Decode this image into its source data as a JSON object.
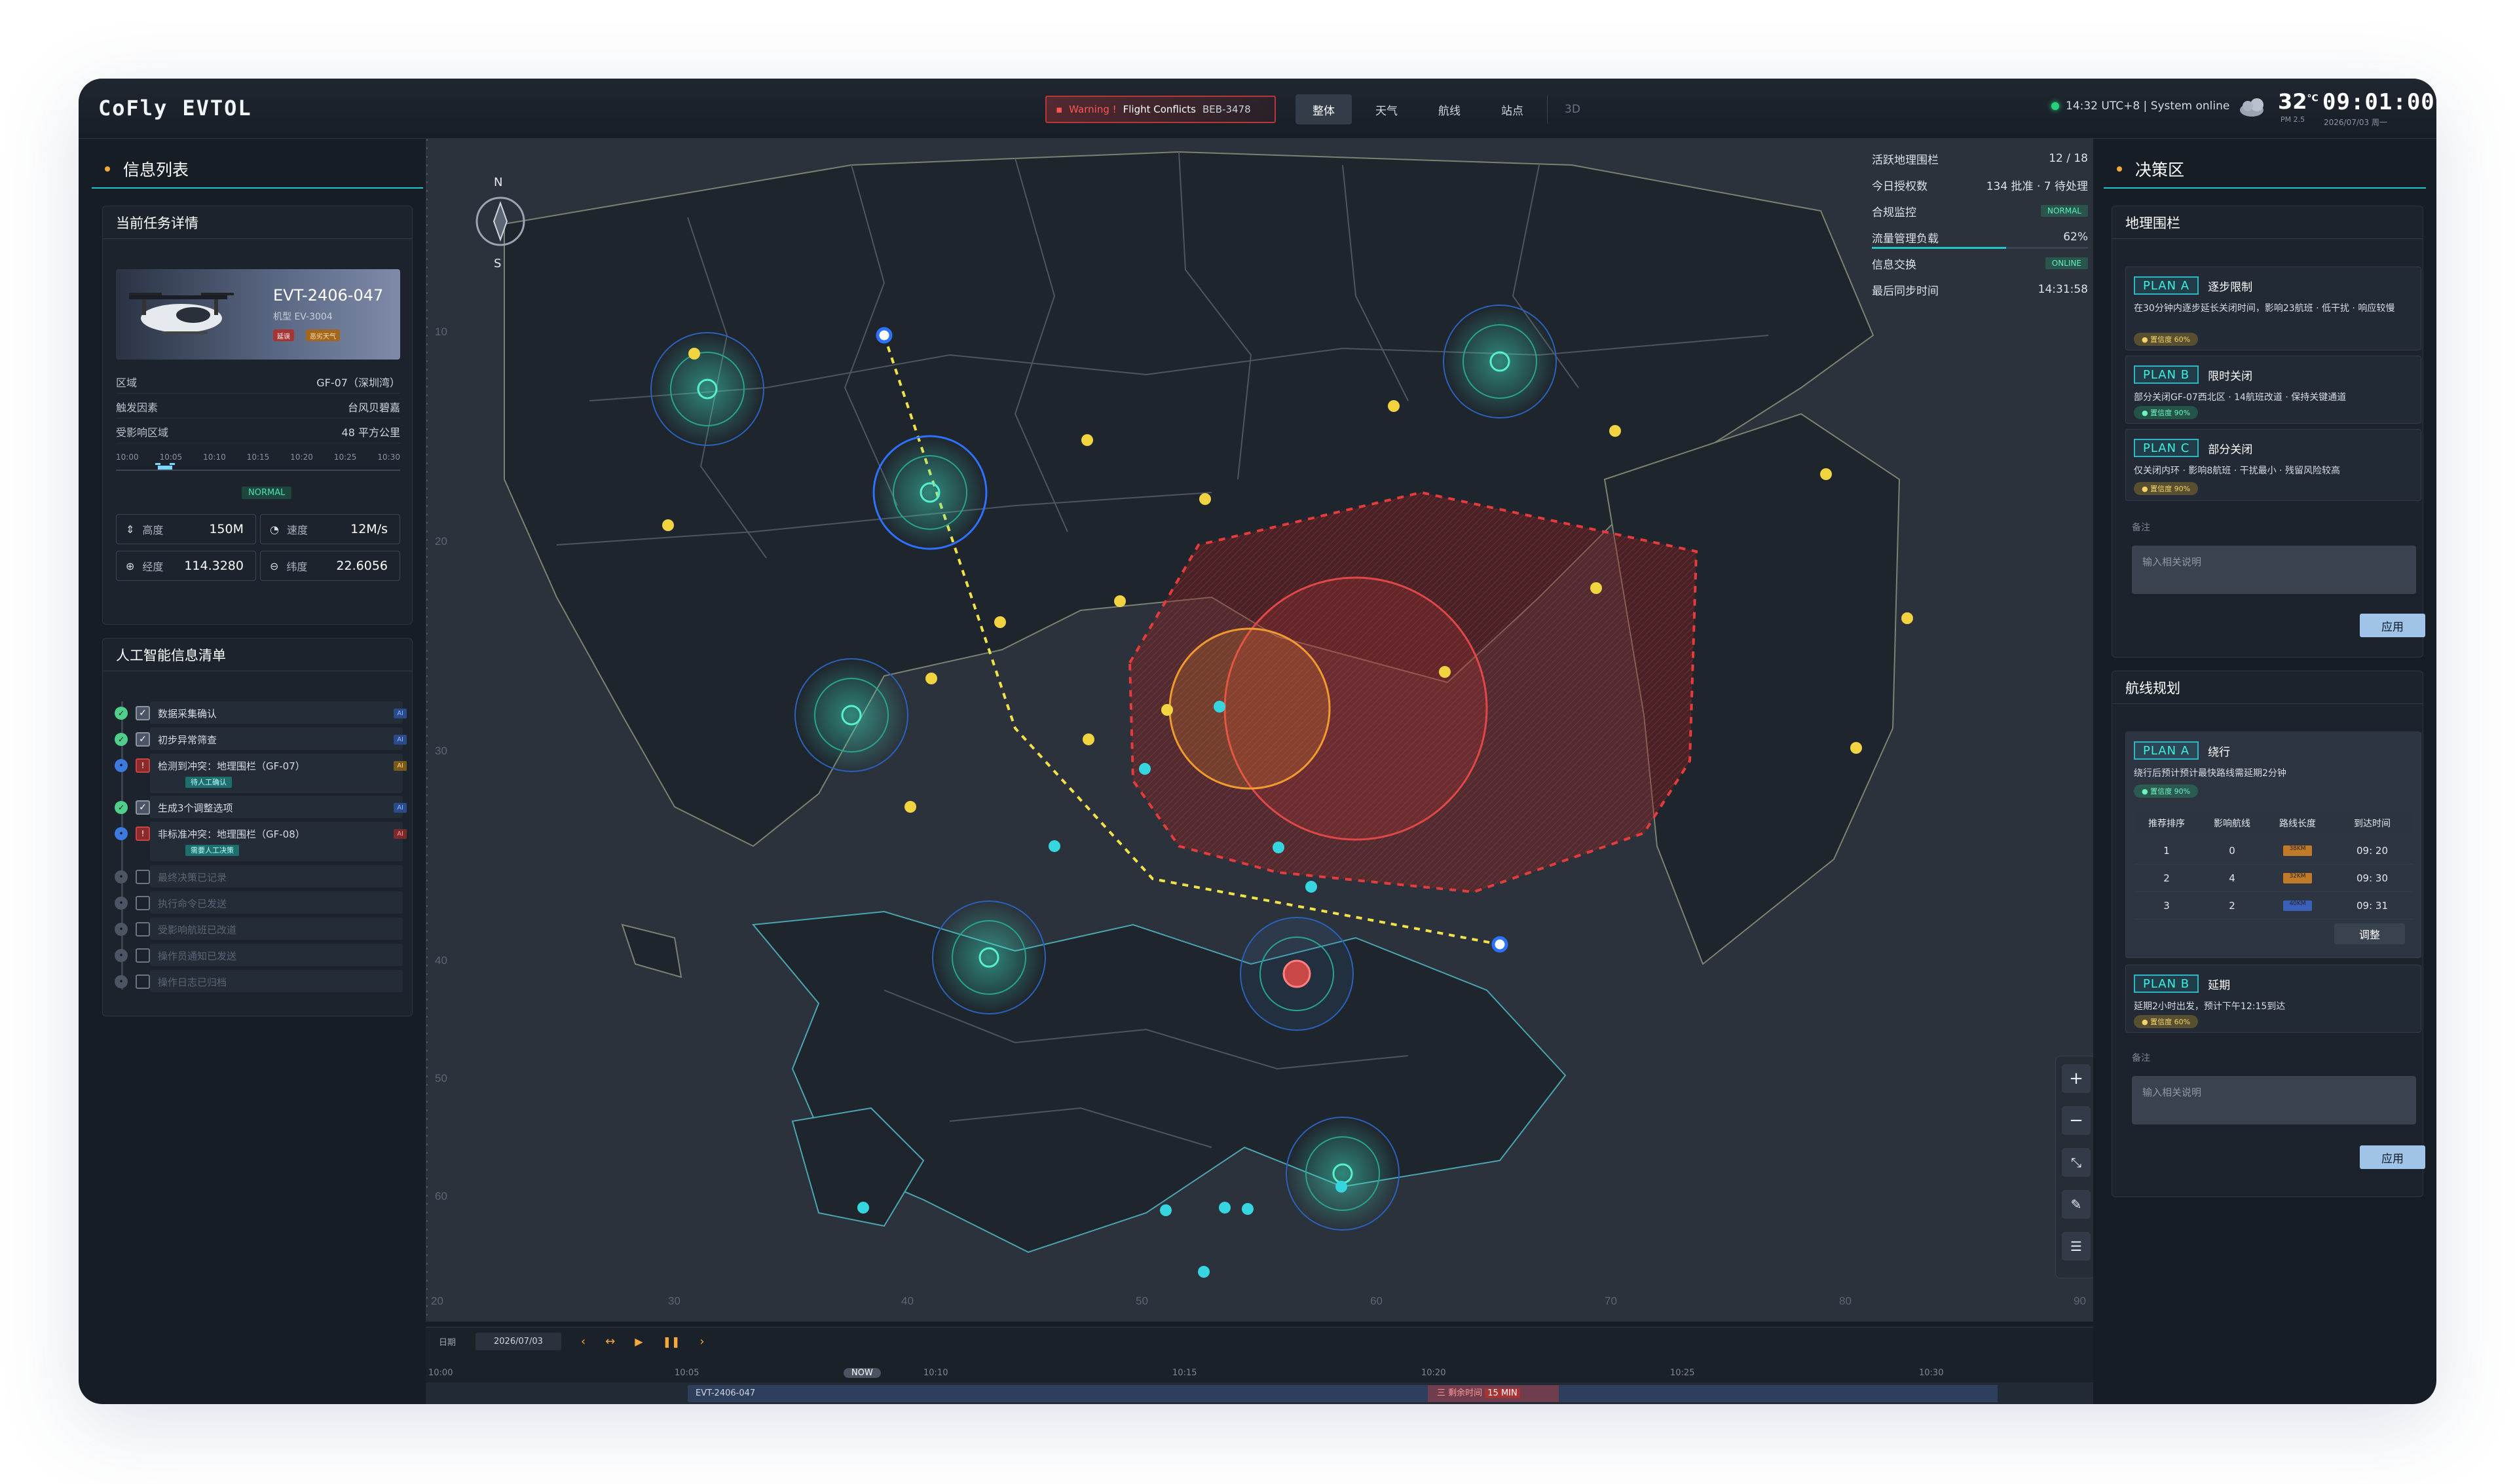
{
  "header": {
    "brand_a": "CoFly",
    "brand_b": "EVTOL",
    "warning_label": "Warning !",
    "warning_text": "Flight Conflicts",
    "warning_code": "BEB-3478",
    "tabs": [
      "整体",
      "天气",
      "航线",
      "站点"
    ],
    "tab_3d": "3D",
    "system_status": "14:32 UTC+8 | System online",
    "temperature": "32",
    "temp_unit": "°C",
    "pm": "PM 2.5",
    "clock": "09:01:00",
    "date": "2026/07/03 周一"
  },
  "left": {
    "title": "信息列表",
    "mission": {
      "header": "当前任务详情",
      "id": "EVT-2406-047",
      "model": "机型 EV-3004",
      "tag1": "延误",
      "tag2": "恶劣天气",
      "rows": [
        {
          "k": "区域",
          "v": "GF-07（深圳湾）"
        },
        {
          "k": "触发因素",
          "v": "台风贝碧嘉"
        },
        {
          "k": "受影响区域",
          "v": "48 平方公里"
        }
      ],
      "timeline": [
        "10:00",
        "10:05",
        "10:10",
        "10:15",
        "10:20",
        "10:25",
        "10:30"
      ],
      "status": "NORMAL",
      "stats": [
        {
          "label": "高度",
          "value": "150M"
        },
        {
          "label": "速度",
          "value": "12M/s"
        },
        {
          "label": "经度",
          "value": "114.3280"
        },
        {
          "label": "纬度",
          "value": "22.6056"
        }
      ]
    },
    "ai": {
      "header": "人工智能信息清单",
      "items": [
        {
          "text": "数据采集确认",
          "state": "done",
          "tag": "AI"
        },
        {
          "text": "初步异常筛查",
          "state": "done",
          "tag": "AI"
        },
        {
          "text": "检测到冲突：地理围栏（GF-07）",
          "state": "alert",
          "tag": "AI",
          "sub": "待人工确认"
        },
        {
          "text": "生成3个调整选项",
          "state": "done",
          "tag": "AI"
        },
        {
          "text": "非标准冲突：地理围栏（GF-08）",
          "state": "alert",
          "tag": "AI",
          "sub": "需要人工决策"
        },
        {
          "text": "最终决策已记录",
          "state": "pending"
        },
        {
          "text": "执行命令已发送",
          "state": "pending"
        },
        {
          "text": "受影响航班已改道",
          "state": "pending"
        },
        {
          "text": "操作员通知已发送",
          "state": "pending"
        },
        {
          "text": "操作日志已归档",
          "state": "pending"
        }
      ]
    }
  },
  "map": {
    "compass_n": "N",
    "compass_s": "S",
    "info": [
      {
        "k": "活跃地理围栏",
        "v": "12 / 18"
      },
      {
        "k": "今日授权数",
        "v": "134 批准 · 7 待处理"
      },
      {
        "k": "合规监控",
        "v": "NORMAL"
      },
      {
        "k": "流量管理负载",
        "v": "62%"
      },
      {
        "k": "信息交换",
        "v": "ONLINE"
      },
      {
        "k": "最后同步时间",
        "v": "14:31:58"
      }
    ],
    "x_ticks": [
      "20",
      "30",
      "40",
      "50",
      "60",
      "70",
      "80",
      "90"
    ],
    "y_ticks": [
      "10",
      "20",
      "30",
      "40",
      "50",
      "60"
    ],
    "zoom": [
      "+",
      "−",
      "⤡",
      "✎",
      "☰"
    ]
  },
  "bottom": {
    "date_label": "日期",
    "date_value": "2026/07/03",
    "times": [
      "10:00",
      "10:05",
      "10:10",
      "10:15",
      "10:20",
      "10:25",
      "10:30"
    ],
    "now": "NOW",
    "track_id": "EVT-2406-047",
    "track_warning": "三 剩余时间",
    "track_warning_tag": "15 MIN"
  },
  "right": {
    "title": "决策区",
    "geofence": {
      "header": "地理围栏",
      "plans": [
        {
          "badge": "PLAN A",
          "name": "逐步限制",
          "desc": "在30分钟内逐步延长关闭时间，影响23航班 · 低干扰 · 响应较慢",
          "trust": "● 置信度 60%"
        },
        {
          "badge": "PLAN B",
          "name": "限时关闭",
          "desc": "部分关闭GF-07西北区 · 14航班改道 · 保持关键通道",
          "trust": "● 置信度 90%"
        },
        {
          "badge": "PLAN C",
          "name": "部分关闭",
          "desc": "仅关闭内环 · 影响8航班 · 干扰最小 · 残留风险较高",
          "trust": "● 置信度 90%"
        }
      ],
      "note_label": "备注",
      "note_placeholder": "输入相关说明",
      "apply": "应用"
    },
    "route": {
      "header": "航线规划",
      "planA": {
        "badge": "PLAN A",
        "name": "绕行",
        "desc": "绕行后预计预计最快路线需延期2分钟",
        "trust": "● 置信度 90%"
      },
      "table_headers": [
        "推荐排序",
        "影响航线",
        "路线长度",
        "到达时间"
      ],
      "rows": [
        {
          "rank": "1",
          "affected": "0",
          "len": "38KM",
          "eta": "09: 20"
        },
        {
          "rank": "2",
          "affected": "4",
          "len": "32KM",
          "eta": "09: 30"
        },
        {
          "rank": "3",
          "affected": "2",
          "len": "40KM",
          "eta": "09: 31"
        }
      ],
      "adjust": "调整",
      "planB": {
        "badge": "PLAN B",
        "name": "延期",
        "desc": "延期2小时出发，预计下午12:15到达",
        "trust": "● 置信度 60%"
      },
      "note_label": "备注",
      "note_placeholder": "输入相关说明",
      "apply": "应用"
    }
  },
  "colors": {
    "accent": "#25c6c6",
    "warning": "#d64545",
    "route": "#f2e24a",
    "marker_yellow": "#f2d440",
    "marker_cyan": "#36d6e0"
  }
}
